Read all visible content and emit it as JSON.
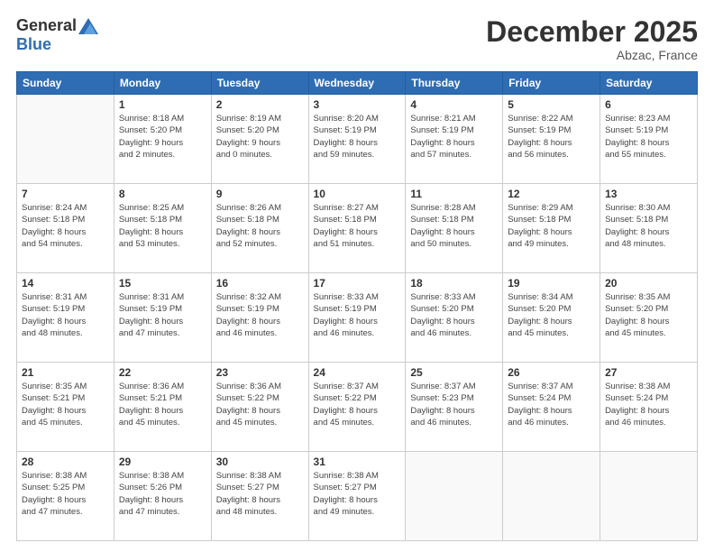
{
  "logo": {
    "general": "General",
    "blue": "Blue"
  },
  "header": {
    "month": "December 2025",
    "location": "Abzac, France"
  },
  "weekdays": [
    "Sunday",
    "Monday",
    "Tuesday",
    "Wednesday",
    "Thursday",
    "Friday",
    "Saturday"
  ],
  "weeks": [
    [
      {
        "num": "",
        "info": ""
      },
      {
        "num": "1",
        "info": "Sunrise: 8:18 AM\nSunset: 5:20 PM\nDaylight: 9 hours\nand 2 minutes."
      },
      {
        "num": "2",
        "info": "Sunrise: 8:19 AM\nSunset: 5:20 PM\nDaylight: 9 hours\nand 0 minutes."
      },
      {
        "num": "3",
        "info": "Sunrise: 8:20 AM\nSunset: 5:19 PM\nDaylight: 8 hours\nand 59 minutes."
      },
      {
        "num": "4",
        "info": "Sunrise: 8:21 AM\nSunset: 5:19 PM\nDaylight: 8 hours\nand 57 minutes."
      },
      {
        "num": "5",
        "info": "Sunrise: 8:22 AM\nSunset: 5:19 PM\nDaylight: 8 hours\nand 56 minutes."
      },
      {
        "num": "6",
        "info": "Sunrise: 8:23 AM\nSunset: 5:19 PM\nDaylight: 8 hours\nand 55 minutes."
      }
    ],
    [
      {
        "num": "7",
        "info": "Sunrise: 8:24 AM\nSunset: 5:18 PM\nDaylight: 8 hours\nand 54 minutes."
      },
      {
        "num": "8",
        "info": "Sunrise: 8:25 AM\nSunset: 5:18 PM\nDaylight: 8 hours\nand 53 minutes."
      },
      {
        "num": "9",
        "info": "Sunrise: 8:26 AM\nSunset: 5:18 PM\nDaylight: 8 hours\nand 52 minutes."
      },
      {
        "num": "10",
        "info": "Sunrise: 8:27 AM\nSunset: 5:18 PM\nDaylight: 8 hours\nand 51 minutes."
      },
      {
        "num": "11",
        "info": "Sunrise: 8:28 AM\nSunset: 5:18 PM\nDaylight: 8 hours\nand 50 minutes."
      },
      {
        "num": "12",
        "info": "Sunrise: 8:29 AM\nSunset: 5:18 PM\nDaylight: 8 hours\nand 49 minutes."
      },
      {
        "num": "13",
        "info": "Sunrise: 8:30 AM\nSunset: 5:18 PM\nDaylight: 8 hours\nand 48 minutes."
      }
    ],
    [
      {
        "num": "14",
        "info": "Sunrise: 8:31 AM\nSunset: 5:19 PM\nDaylight: 8 hours\nand 48 minutes."
      },
      {
        "num": "15",
        "info": "Sunrise: 8:31 AM\nSunset: 5:19 PM\nDaylight: 8 hours\nand 47 minutes."
      },
      {
        "num": "16",
        "info": "Sunrise: 8:32 AM\nSunset: 5:19 PM\nDaylight: 8 hours\nand 46 minutes."
      },
      {
        "num": "17",
        "info": "Sunrise: 8:33 AM\nSunset: 5:19 PM\nDaylight: 8 hours\nand 46 minutes."
      },
      {
        "num": "18",
        "info": "Sunrise: 8:33 AM\nSunset: 5:20 PM\nDaylight: 8 hours\nand 46 minutes."
      },
      {
        "num": "19",
        "info": "Sunrise: 8:34 AM\nSunset: 5:20 PM\nDaylight: 8 hours\nand 45 minutes."
      },
      {
        "num": "20",
        "info": "Sunrise: 8:35 AM\nSunset: 5:20 PM\nDaylight: 8 hours\nand 45 minutes."
      }
    ],
    [
      {
        "num": "21",
        "info": "Sunrise: 8:35 AM\nSunset: 5:21 PM\nDaylight: 8 hours\nand 45 minutes."
      },
      {
        "num": "22",
        "info": "Sunrise: 8:36 AM\nSunset: 5:21 PM\nDaylight: 8 hours\nand 45 minutes."
      },
      {
        "num": "23",
        "info": "Sunrise: 8:36 AM\nSunset: 5:22 PM\nDaylight: 8 hours\nand 45 minutes."
      },
      {
        "num": "24",
        "info": "Sunrise: 8:37 AM\nSunset: 5:22 PM\nDaylight: 8 hours\nand 45 minutes."
      },
      {
        "num": "25",
        "info": "Sunrise: 8:37 AM\nSunset: 5:23 PM\nDaylight: 8 hours\nand 46 minutes."
      },
      {
        "num": "26",
        "info": "Sunrise: 8:37 AM\nSunset: 5:24 PM\nDaylight: 8 hours\nand 46 minutes."
      },
      {
        "num": "27",
        "info": "Sunrise: 8:38 AM\nSunset: 5:24 PM\nDaylight: 8 hours\nand 46 minutes."
      }
    ],
    [
      {
        "num": "28",
        "info": "Sunrise: 8:38 AM\nSunset: 5:25 PM\nDaylight: 8 hours\nand 47 minutes."
      },
      {
        "num": "29",
        "info": "Sunrise: 8:38 AM\nSunset: 5:26 PM\nDaylight: 8 hours\nand 47 minutes."
      },
      {
        "num": "30",
        "info": "Sunrise: 8:38 AM\nSunset: 5:27 PM\nDaylight: 8 hours\nand 48 minutes."
      },
      {
        "num": "31",
        "info": "Sunrise: 8:38 AM\nSunset: 5:27 PM\nDaylight: 8 hours\nand 49 minutes."
      },
      {
        "num": "",
        "info": ""
      },
      {
        "num": "",
        "info": ""
      },
      {
        "num": "",
        "info": ""
      }
    ]
  ]
}
